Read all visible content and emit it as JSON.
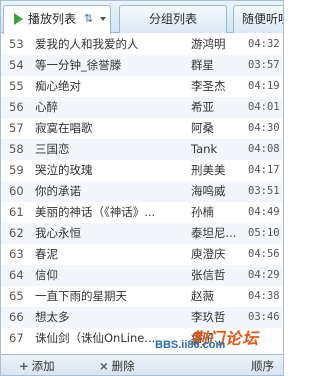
{
  "tabs": {
    "playlist": "播放列表",
    "sort_icon": "⇅",
    "group": "分组列表",
    "random": "随便听听"
  },
  "songs": [
    {
      "num": "53",
      "title": "爱我的人和我爱的人",
      "artist": "游鸿明",
      "time": "04:32"
    },
    {
      "num": "54",
      "title": "等一分钟_徐誉滕",
      "artist": "群星",
      "time": "03:57"
    },
    {
      "num": "55",
      "title": "痴心绝对",
      "artist": "李圣杰",
      "time": "04:19"
    },
    {
      "num": "56",
      "title": "心醉",
      "artist": "希亚",
      "time": "04:01"
    },
    {
      "num": "57",
      "title": "寂寞在唱歌",
      "artist": "阿桑",
      "time": "04:30"
    },
    {
      "num": "58",
      "title": "三国恋",
      "artist": "Tank",
      "time": "04:08"
    },
    {
      "num": "59",
      "title": "哭泣的玫瑰",
      "artist": "刑美美",
      "time": "04:17"
    },
    {
      "num": "60",
      "title": "你的承诺",
      "artist": "海鸣威",
      "time": "03:51"
    },
    {
      "num": "61",
      "title": "美丽的神话（《神话》...",
      "artist": "孙楠",
      "time": "04:49"
    },
    {
      "num": "62",
      "title": "我心永恒",
      "artist": "泰坦尼...",
      "time": "05:10"
    },
    {
      "num": "63",
      "title": "春泥",
      "artist": "庾澄庆",
      "time": "04:56"
    },
    {
      "num": "64",
      "title": "信仰",
      "artist": "张信哲",
      "time": "04:29"
    },
    {
      "num": "65",
      "title": "一直下雨的星期天",
      "artist": "赵薇",
      "time": "04:38"
    },
    {
      "num": "66",
      "title": "想太多",
      "artist": "李玖哲",
      "time": "03:46"
    },
    {
      "num": "67",
      "title": "诛仙剑（诛仙OnLine...",
      "artist": "痞子..."
    }
  ],
  "toolbar": {
    "add_icon": "+",
    "add_label": "添加",
    "delete_icon": "×",
    "delete_label": "删除",
    "order_label": "顺序"
  },
  "watermark": {
    "text": "荆门论坛",
    "url": "BBS.ii86.com"
  },
  "colors": {
    "tab_border": "#9fb8d1",
    "play_icon": "#3aa339",
    "watermark_orange": "#e05a1c",
    "watermark_blue": "#2b6cb3"
  }
}
